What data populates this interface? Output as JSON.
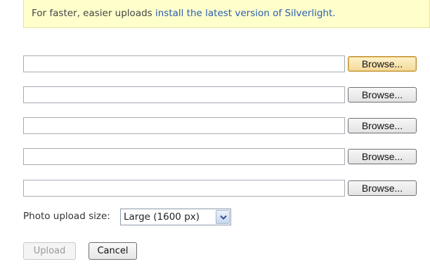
{
  "notice": {
    "text": "For faster, easier uploads ",
    "link": "install the latest version of Silverlight."
  },
  "file_rows": [
    {
      "value": "",
      "browse_label": "Browse..."
    },
    {
      "value": "",
      "browse_label": "Browse..."
    },
    {
      "value": "",
      "browse_label": "Browse..."
    },
    {
      "value": "",
      "browse_label": "Browse..."
    },
    {
      "value": "",
      "browse_label": "Browse..."
    }
  ],
  "photo_size": {
    "label": "Photo upload size:",
    "selected": "Large (1600 px)"
  },
  "actions": {
    "upload_label": "Upload",
    "cancel_label": "Cancel"
  },
  "colors": {
    "notice_bg": "#ffffcc",
    "link": "#2a5db0",
    "focused_button": "#f3d99a"
  },
  "icons": {
    "select_arrow": "chevron-down-icon"
  }
}
